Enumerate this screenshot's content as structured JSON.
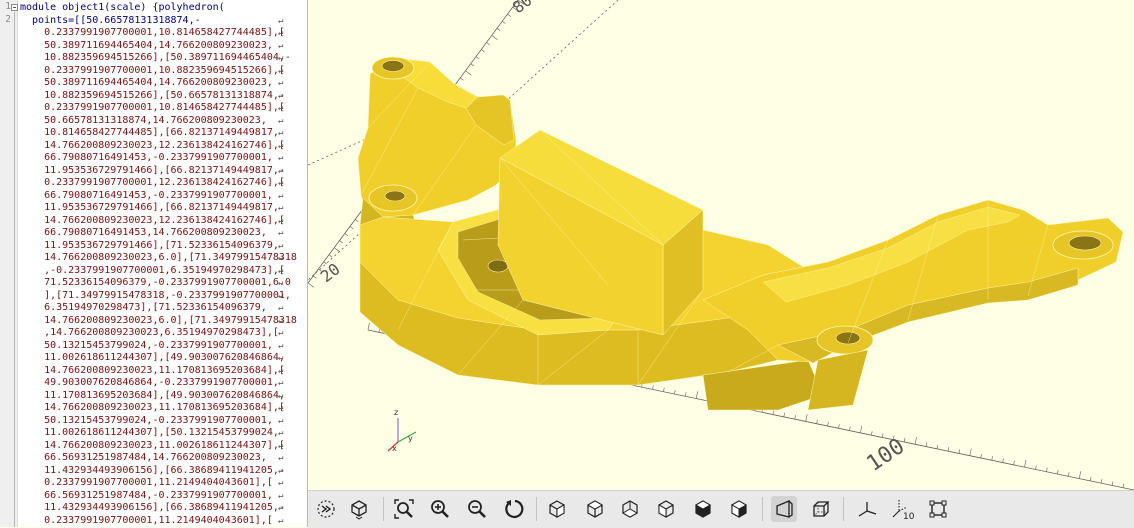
{
  "editor": {
    "line_numbers": [
      "1",
      "2"
    ],
    "lines": [
      {
        "text": "module object1(scale) {polyhedron(",
        "wrap": false,
        "kind": "kw"
      },
      {
        "text": "  points=[[50.66578131318874,-",
        "wrap": true,
        "kind": "kw"
      },
      {
        "text": "    0.2337991907700001,10.814658427744485],[",
        "wrap": true,
        "kind": "nm"
      },
      {
        "text": "    50.389711694465404,14.766200809230023,",
        "wrap": true,
        "kind": "nm"
      },
      {
        "text": "    10.882359694515266],[50.389711694465404,-",
        "wrap": true,
        "kind": "nm"
      },
      {
        "text": "    0.2337991907700001,10.882359694515266],[",
        "wrap": true,
        "kind": "nm"
      },
      {
        "text": "    50.389711694465404,14.766200809230023,",
        "wrap": true,
        "kind": "nm"
      },
      {
        "text": "    10.882359694515266],[50.66578131318874,-",
        "wrap": true,
        "kind": "nm"
      },
      {
        "text": "    0.2337991907700001,10.814658427744485],[",
        "wrap": true,
        "kind": "nm"
      },
      {
        "text": "    50.66578131318874,14.766200809230023,",
        "wrap": true,
        "kind": "nm"
      },
      {
        "text": "    10.814658427744485],[66.82137149449817,",
        "wrap": true,
        "kind": "nm"
      },
      {
        "text": "    14.766200809230023,12.236138424162746],[",
        "wrap": true,
        "kind": "nm"
      },
      {
        "text": "    66.79080716491453,-0.2337991907700001,",
        "wrap": true,
        "kind": "nm"
      },
      {
        "text": "    11.953536729791466],[66.82137149449817,-",
        "wrap": true,
        "kind": "nm"
      },
      {
        "text": "    0.2337991907700001,12.236138424162746],[",
        "wrap": true,
        "kind": "nm"
      },
      {
        "text": "    66.79080716491453,-0.2337991907700001,",
        "wrap": true,
        "kind": "nm"
      },
      {
        "text": "    11.953536729791466],[66.82137149449817,",
        "wrap": true,
        "kind": "nm"
      },
      {
        "text": "    14.766200809230023,12.236138424162746],[",
        "wrap": true,
        "kind": "nm"
      },
      {
        "text": "    66.79080716491453,14.766200809230023,",
        "wrap": true,
        "kind": "nm"
      },
      {
        "text": "    11.953536729791466],[71.52336154096379,",
        "wrap": true,
        "kind": "nm"
      },
      {
        "text": "    14.766200809230023,6.0],[71.34979915478318",
        "wrap": true,
        "kind": "nm"
      },
      {
        "text": "    ,-0.2337991907700001,6.35194970298473],[",
        "wrap": true,
        "kind": "nm"
      },
      {
        "text": "    71.52336154096379,-0.2337991907700001,6.0",
        "wrap": true,
        "kind": "nm"
      },
      {
        "text": "    ],[71.34979915478318,-0.2337991907700001,",
        "wrap": true,
        "kind": "nm"
      },
      {
        "text": "    6.35194970298473],[71.52336154096379,",
        "wrap": true,
        "kind": "nm"
      },
      {
        "text": "    14.766200809230023,6.0],[71.34979915478318",
        "wrap": true,
        "kind": "nm"
      },
      {
        "text": "    ,14.766200809230023,6.35194970298473],[",
        "wrap": true,
        "kind": "nm"
      },
      {
        "text": "    50.13215453799024,-0.2337991907700001,",
        "wrap": true,
        "kind": "nm"
      },
      {
        "text": "    11.002618611244307],[49.903007620846864,",
        "wrap": true,
        "kind": "nm"
      },
      {
        "text": "    14.766200809230023,11.170813695203684],[",
        "wrap": true,
        "kind": "nm"
      },
      {
        "text": "    49.903007620846864,-0.2337991907700001,",
        "wrap": true,
        "kind": "nm"
      },
      {
        "text": "    11.170813695203684],[49.903007620846864,",
        "wrap": true,
        "kind": "nm"
      },
      {
        "text": "    14.766200809230023,11.170813695203684],[",
        "wrap": true,
        "kind": "nm"
      },
      {
        "text": "    50.13215453799024,-0.2337991907700001,",
        "wrap": true,
        "kind": "nm"
      },
      {
        "text": "    11.002618611244307],[50.13215453799024,",
        "wrap": true,
        "kind": "nm"
      },
      {
        "text": "    14.766200809230023,11.002618611244307],[",
        "wrap": true,
        "kind": "nm"
      },
      {
        "text": "    66.56931251987484,14.766200809230023,",
        "wrap": true,
        "kind": "nm"
      },
      {
        "text": "    11.432934493906156],[66.38689411941205,-",
        "wrap": true,
        "kind": "nm"
      },
      {
        "text": "    0.2337991907700001,11.2149404043601],[",
        "wrap": true,
        "kind": "nm"
      },
      {
        "text": "    66.56931251987484,-0.2337991907700001,",
        "wrap": true,
        "kind": "nm"
      },
      {
        "text": "    11.432934493906156],[66.38689411941205,-",
        "wrap": true,
        "kind": "nm"
      },
      {
        "text": "    0.2337991907700001,11.2149404043601],[",
        "wrap": true,
        "kind": "nm"
      },
      {
        "text": "    66.56931251987484,14.766200809230023,",
        "wrap": true,
        "kind": "nm"
      },
      {
        "text": "    11.432934493906156],[66.38689411941205,",
        "wrap": true,
        "kind": "nm"
      }
    ]
  },
  "viewport": {
    "ruler_labels": {
      "top": "80",
      "left": "20",
      "bottom": "100"
    },
    "axis_labels": {
      "z": "z",
      "y": "y",
      "x": "x"
    },
    "model_color": "#f5d330",
    "edge_color": "#fff6b0",
    "background": "#ffffe5"
  },
  "toolbar": {
    "axes_scale_label": "10",
    "buttons": [
      {
        "name": "animate-button",
        "icon": "animate-icon"
      },
      {
        "name": "view-all-button",
        "icon": "view-all-icon"
      },
      {
        "name": "zoom-fit-button",
        "icon": "zoom-fit-icon"
      },
      {
        "name": "zoom-in-button",
        "icon": "zoom-in-icon"
      },
      {
        "name": "zoom-out-button",
        "icon": "zoom-out-icon"
      },
      {
        "name": "reset-view-button",
        "icon": "reset-view-icon"
      },
      {
        "name": "view-right-button",
        "icon": "cube-right-icon"
      },
      {
        "name": "view-top-button",
        "icon": "cube-top-icon"
      },
      {
        "name": "view-bottom-button",
        "icon": "cube-bottom-icon"
      },
      {
        "name": "view-left-button",
        "icon": "cube-left-icon"
      },
      {
        "name": "view-front-button",
        "icon": "cube-front-icon"
      },
      {
        "name": "view-back-button",
        "icon": "cube-back-icon"
      },
      {
        "name": "perspective-button",
        "icon": "perspective-icon"
      },
      {
        "name": "orthogonal-button",
        "icon": "orthogonal-icon"
      },
      {
        "name": "show-axes-button",
        "icon": "axes-icon"
      },
      {
        "name": "show-scale-button",
        "icon": "scale-markers-icon"
      },
      {
        "name": "show-edges-button",
        "icon": "edges-icon"
      }
    ]
  }
}
